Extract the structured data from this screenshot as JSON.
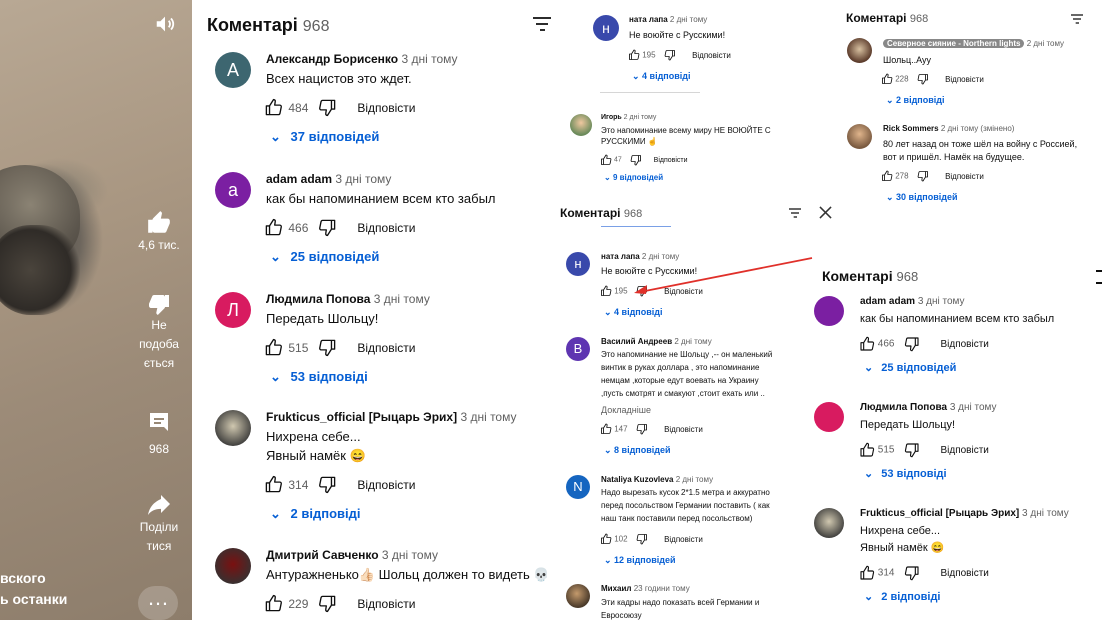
{
  "video": {
    "likes": "4,6 тис.",
    "dislike_l1": "Не",
    "dislike_l2": "подоба",
    "dislike_l3": "ється",
    "comments": "968",
    "share_l1": "Поділи",
    "share_l2": "тися",
    "cap1": "вского",
    "cap2": "ь останки",
    "more": "…"
  },
  "main": {
    "title": "Коментарі",
    "count": "968",
    "reply": "Відповісти",
    "comments": [
      {
        "letter": "А",
        "color": "#3d6670",
        "author": "Александр Борисенко",
        "time": "3 дні тому",
        "text": [
          "Всех нацистов это ждет."
        ],
        "likes": "484",
        "replies": "37 відповідей"
      },
      {
        "letter": "a",
        "color": "#7b1fa2",
        "author": "adam adam",
        "time": "3 дні тому",
        "text": [
          "как бы напоминанием всем кто забыл"
        ],
        "likes": "466",
        "replies": "25 відповідей"
      },
      {
        "letter": "Л",
        "color": "#d81b60",
        "author": "Людмила Попова",
        "time": "3 дні тому",
        "text": [
          "Передать Шольцу!"
        ],
        "likes": "515",
        "replies": "53 відповіді"
      },
      {
        "letter": "",
        "color": "#d0c8b0",
        "author": "Frukticus_official [Рыцарь Эрих]",
        "time": "3 дні тому",
        "text": [
          "Нихрена себе...",
          "Явный намёк 😄"
        ],
        "likes": "314",
        "replies": "2 відповіді"
      },
      {
        "letter": "",
        "color": "#7a1010",
        "author": "Дмитрий Савченко",
        "time": "3 дні тому",
        "text": [
          "Антуражненько👍🏻 Шольц должен то видеть 💀"
        ],
        "likes": "229",
        "replies": ""
      }
    ]
  },
  "top": {
    "author": "ната лапа",
    "time": "2 дні тому",
    "text": "Не воюйте с Русскими!",
    "likes": "195",
    "reply": "Відповісти",
    "replies": "4 відповіді",
    "letter": "н",
    "c2_author": "Игорь",
    "c2_time": "2 дні тому",
    "c2_text1": "Это напоминание всему миру НЕ ВОЮЙТЕ С",
    "c2_text2": "РУССКИМИ ☝️",
    "c2_likes": "47",
    "c2_replies": "9 відповідей"
  },
  "mid": {
    "title": "Коментарі",
    "count": "968",
    "reply": "Відповісти",
    "c1": {
      "letter": "н",
      "author": "ната лапа",
      "time": "2 дні тому",
      "text": "Не воюйте с Русскими!",
      "likes": "195",
      "replies": "4 відповіді"
    },
    "c2": {
      "letter": "В",
      "author": "Василий Андреев",
      "time": "2 дні тому",
      "text": [
        "Это напоминание не Шольцу ,-- он маленький",
        "винтик в руках доллара , это напоминание",
        "немцам ,которые едут воевать на Украину",
        ",пусть смотрят и смакуют ,стоит ехать или .."
      ],
      "more": "Докладніше",
      "likes": "147",
      "replies": "8 відповідей"
    },
    "c3": {
      "letter": "N",
      "author": "Nataliya Kuzovleva",
      "time": "2 дні тому",
      "text": [
        "Надо вырезать кусок 2*1.5 метра и аккуратно",
        "перед посольством Германии поставить ( как",
        "наш танк поставили перед посольством)"
      ],
      "likes": "102",
      "replies": "12 відповідей"
    },
    "c4": {
      "author": "Михаил",
      "time": "23 години тому",
      "text": [
        "Эти кадры надо показать всей Германии и",
        "Евросоюзу"
      ]
    }
  },
  "right": {
    "title": "Коментарі",
    "count": "968",
    "reply": "Відповісти",
    "c1": {
      "author": "Северное сияние - Northern lights",
      "time": "2 дні тому",
      "text": "Шольц..Ауу",
      "likes": "228",
      "replies": "2 відповіді"
    },
    "c2": {
      "author": "Rick Sommers",
      "time": "2 дні тому (змінено)",
      "text": [
        "80 лет назад он тоже шёл на войну с Россией,",
        "вот и пришёл. Намёк на будущее."
      ],
      "likes": "278",
      "replies": "30 відповідей"
    }
  },
  "right2": {
    "title": "Коментарі",
    "count": "968",
    "reply": "Відповісти",
    "comments": [
      {
        "author": "adam adam",
        "time": "3 дні тому",
        "text": [
          "как бы напоминанием всем кто забыл"
        ],
        "likes": "466",
        "replies": "25 відповідей"
      },
      {
        "author": "Людмила Попова",
        "time": "3 дні тому",
        "text": [
          "Передать Шольцу!"
        ],
        "likes": "515",
        "replies": "53 відповіді"
      },
      {
        "author": "Frukticus_official [Рыцарь Эрих]",
        "time": "3 дні тому",
        "text": [
          "Нихрена себе...",
          "Явный намёк 😄"
        ],
        "likes": "314",
        "replies": "2 відповіді"
      }
    ]
  },
  "colors": {
    "link": "#065fd4",
    "arrow": "#e0302a"
  }
}
